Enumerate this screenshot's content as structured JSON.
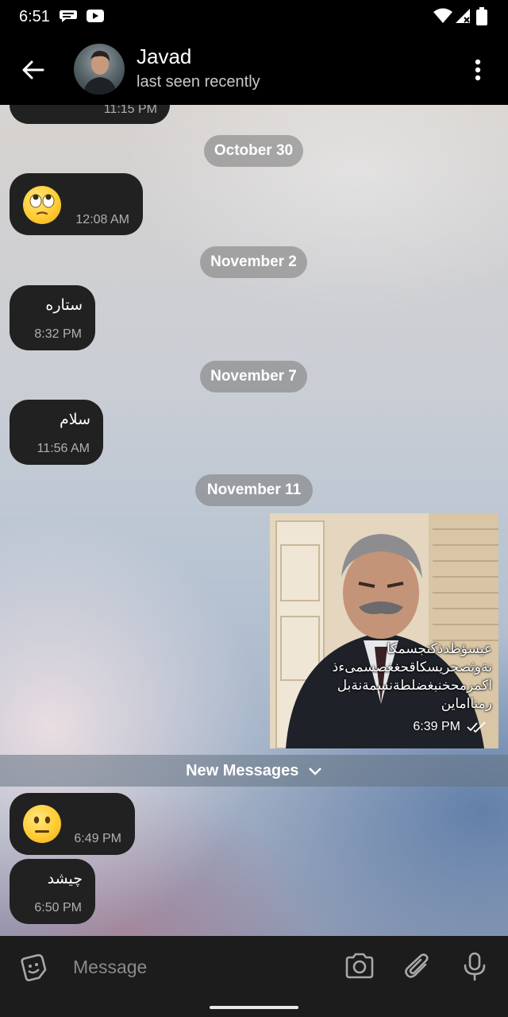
{
  "status_bar": {
    "time": "6:51",
    "icons": [
      "chat-bubble-icon",
      "youtube-icon",
      "wifi-icon",
      "signal-icon",
      "battery-icon"
    ]
  },
  "header": {
    "contact_name": "Javad",
    "contact_status": "last seen recently",
    "back_icon": "arrow-left-icon",
    "more_icon": "more-vert-icon"
  },
  "messages": [
    {
      "type": "partial",
      "time": "11:15 PM"
    },
    {
      "type": "date",
      "label": "October 30"
    },
    {
      "type": "emoji",
      "emoji": "face-rolling-eyes",
      "time": "12:08 AM"
    },
    {
      "type": "date",
      "label": "November 2"
    },
    {
      "type": "text",
      "text": "ستاره",
      "time": "8:32 PM"
    },
    {
      "type": "date",
      "label": "November 7"
    },
    {
      "type": "text",
      "text": "سلام",
      "time": "11:56 AM"
    },
    {
      "type": "date",
      "label": "November 11"
    },
    {
      "type": "image",
      "caption_lines": [
        "عيسؤظدذكتجسمكا",
        "نةوثصحريسكاقحغغصسمىءذ",
        "اكمرمحخنبغضلطةنسمةنةبل",
        "رمنااماين"
      ],
      "time": "6:39 PM",
      "outgoing": true,
      "read": true
    },
    {
      "type": "divider",
      "label": "New Messages"
    },
    {
      "type": "emoji",
      "emoji": "neutral-face",
      "time": "6:49 PM"
    },
    {
      "type": "text",
      "text": "چیشد",
      "time": "6:50 PM"
    }
  ],
  "input_bar": {
    "placeholder": "Message",
    "icons": [
      "sticker-icon",
      "camera-icon",
      "attach-icon",
      "microphone-icon"
    ]
  },
  "colors": {
    "bubble": "#212121",
    "bar": "#000000",
    "input_bar": "#1c1c1c",
    "accent_text": "#ffffff"
  }
}
